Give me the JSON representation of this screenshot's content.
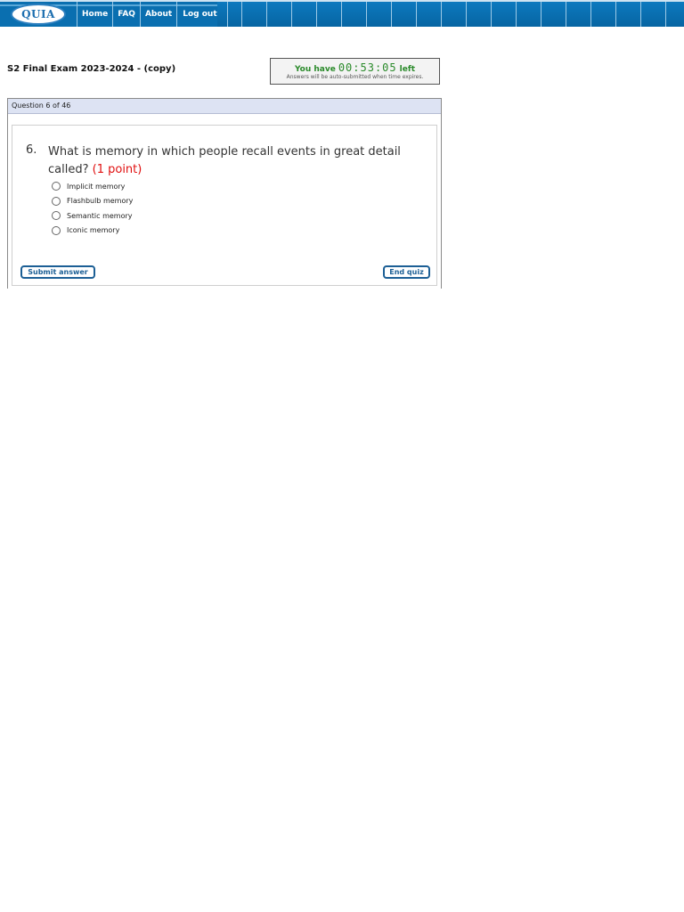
{
  "header": {
    "logo_text": "QUIA",
    "nav": [
      {
        "label": "Home"
      },
      {
        "label": "FAQ"
      },
      {
        "label": "About"
      },
      {
        "label": "Log out"
      }
    ]
  },
  "exam": {
    "title": "S2 Final Exam 2023-2024 - (copy)"
  },
  "timer": {
    "prefix": "You have",
    "time": "00:53:05",
    "suffix": "left",
    "note": "Answers will be auto-submitted when time expires."
  },
  "question": {
    "progress": "Question 6 of 46",
    "number": "6.",
    "text": "What is memory in which people recall events in great detail called?",
    "points": "(1 point)",
    "options": [
      {
        "label": "Implicit memory",
        "selected": false
      },
      {
        "label": "Flashbulb memory",
        "selected": false
      },
      {
        "label": "Semantic memory",
        "selected": false
      },
      {
        "label": "Iconic memory",
        "selected": false
      }
    ]
  },
  "buttons": {
    "submit_label": "Submit answer",
    "end_label": "End quiz"
  },
  "colors": {
    "topbar": "#0a6fb0",
    "timer_text": "#2a8a2a",
    "points_text": "#e01010",
    "button_border": "#1c5f95"
  }
}
